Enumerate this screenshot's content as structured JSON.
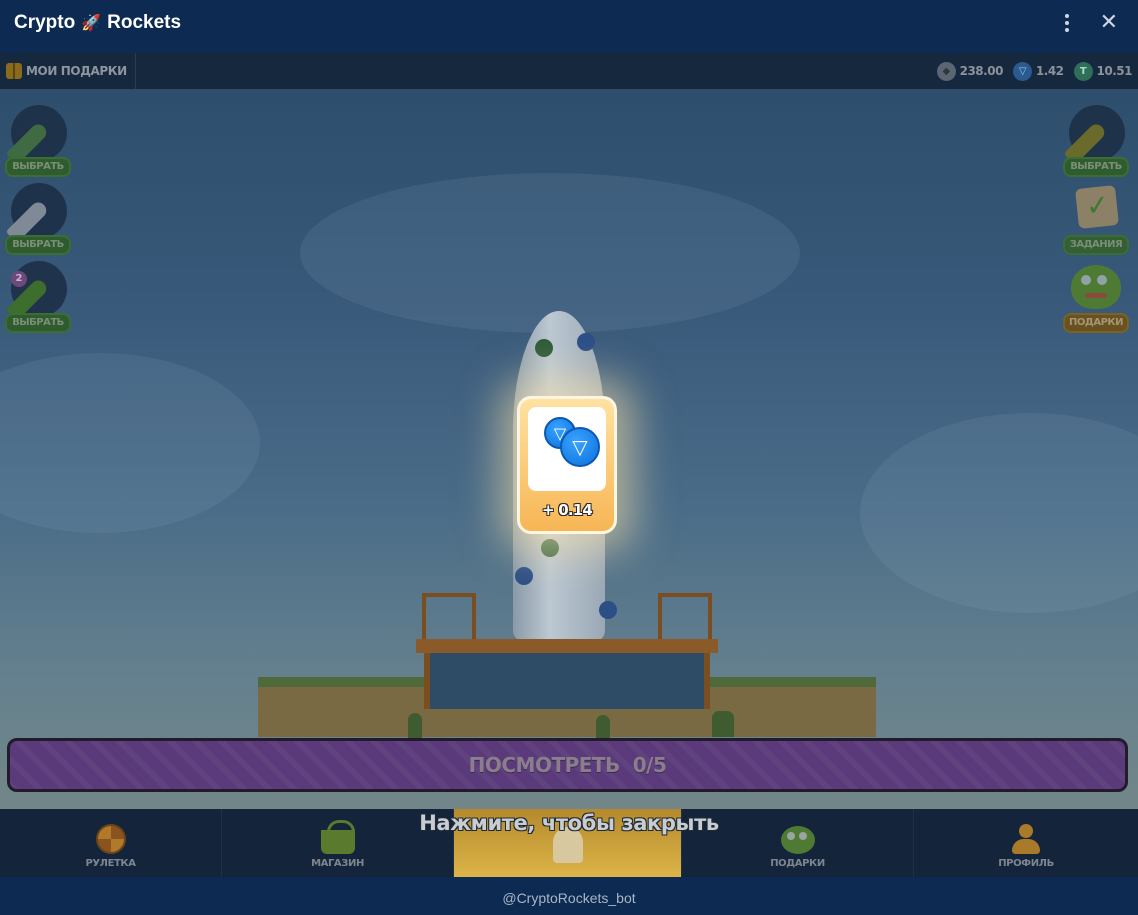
{
  "window": {
    "title_prefix": "Crypto",
    "title_emoji": "🚀",
    "title_suffix": "Rockets"
  },
  "topbar": {
    "my_gifts_label": "МОИ ПОДАРКИ",
    "balances": [
      {
        "icon": "grey-coin-icon",
        "value": "238.00"
      },
      {
        "icon": "ton-coin-icon",
        "value": "1.42"
      },
      {
        "icon": "usdt-coin-icon",
        "value": "10.51"
      }
    ]
  },
  "left_slots": [
    {
      "button": "ВЫБРАТЬ",
      "rocket_color": "#3f6a42"
    },
    {
      "button": "ВЫБРАТЬ",
      "rocket_color": "#7f8a96"
    },
    {
      "button": "ВЫБРАТЬ",
      "rocket_color": "#3d6e2e",
      "badge": "2"
    }
  ],
  "right_slots": [
    {
      "button": "ВЫБРАТЬ",
      "icon": "rocket-icon"
    },
    {
      "button": "ЗАДАНИЯ",
      "icon": "tasks-check-icon"
    },
    {
      "button": "ПОДАРКИ",
      "icon": "pepe-frog-icon"
    }
  ],
  "reward": {
    "amount": "+ 0.14",
    "coin_glyph": "▽",
    "icon": "ton-coins-icon"
  },
  "watch_button": {
    "label": "ПОСМОТРЕТЬ  0/5"
  },
  "close_hint": "Нажмите, чтобы закрыть",
  "bottom_nav": [
    {
      "label": "РУЛЕТКА",
      "icon": "roulette-wheel-icon"
    },
    {
      "label": "МАГАЗИН",
      "icon": "shop-basket-icon"
    },
    {
      "label": "",
      "icon": "launch-rocket-icon",
      "active": true
    },
    {
      "label": "ПОДАРКИ",
      "icon": "pepe-gift-icon"
    },
    {
      "label": "ПРОФИЛЬ",
      "icon": "profile-icon"
    }
  ],
  "footer": {
    "bot_handle": "@CryptoRockets_bot"
  },
  "colors": {
    "titlebar_bg": "#0c2a52",
    "watch_button_bg": "#5a3a7a",
    "reward_card_bg": "#f7b655",
    "active_nav_bg": "#ddb448"
  }
}
